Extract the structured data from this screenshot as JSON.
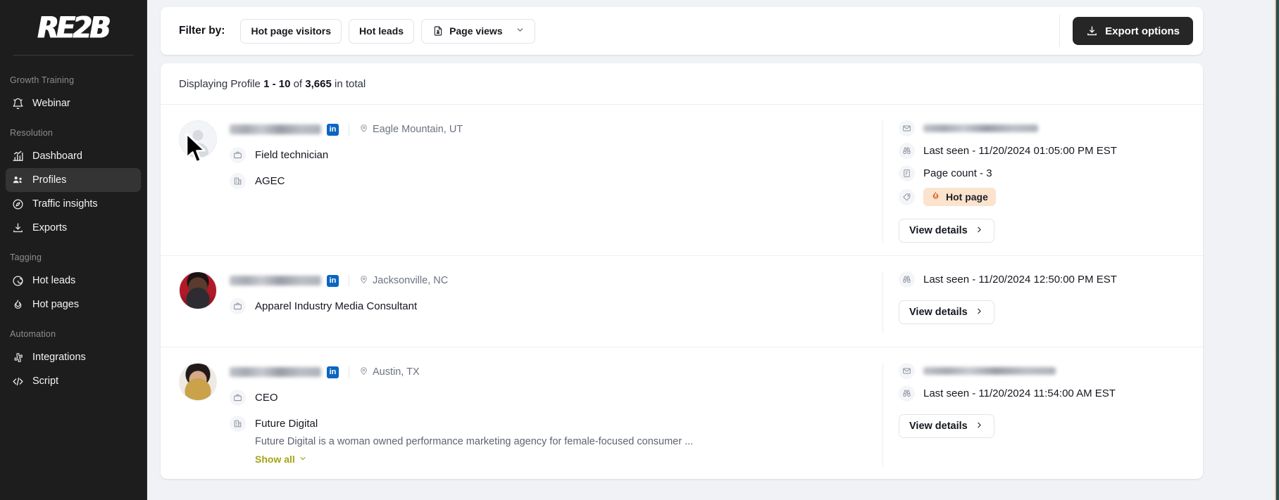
{
  "brand": {
    "logo_text": "RE2B"
  },
  "sidebar": {
    "sections": [
      {
        "title": "Growth Training",
        "items": [
          {
            "label": "Webinar",
            "icon": "bell-icon",
            "active": false
          }
        ]
      },
      {
        "title": "Resolution",
        "items": [
          {
            "label": "Dashboard",
            "icon": "chart-icon",
            "active": false
          },
          {
            "label": "Profiles",
            "icon": "people-icon",
            "active": true
          },
          {
            "label": "Traffic insights",
            "icon": "compass-icon",
            "active": false
          },
          {
            "label": "Exports",
            "icon": "download-icon",
            "active": false
          }
        ]
      },
      {
        "title": "Tagging",
        "items": [
          {
            "label": "Hot leads",
            "icon": "target-icon",
            "active": false
          },
          {
            "label": "Hot pages",
            "icon": "flame-icon",
            "active": false
          }
        ]
      },
      {
        "title": "Automation",
        "items": [
          {
            "label": "Integrations",
            "icon": "puzzle-icon",
            "active": false
          },
          {
            "label": "Script",
            "icon": "code-icon",
            "active": false
          }
        ]
      }
    ]
  },
  "filter_bar": {
    "label": "Filter by:",
    "chips": [
      {
        "label": "Hot page visitors",
        "icon": null,
        "has_chevron": false
      },
      {
        "label": "Hot leads",
        "icon": null,
        "has_chevron": false
      },
      {
        "label": "Page views",
        "icon": "page-icon",
        "has_chevron": true
      }
    ],
    "export_button": {
      "label": "Export options",
      "icon": "download-icon"
    }
  },
  "list": {
    "summary": {
      "prefix": "Displaying Profile",
      "range": "1 - 10",
      "of": "of",
      "total": "3,665",
      "suffix": "in total"
    },
    "profiles": [
      {
        "name_redacted": true,
        "linkedin_badge": "in",
        "location": "Eagle Mountain, UT",
        "avatar": "placeholder",
        "job_title": "Field technician",
        "company": "AGEC",
        "description": null,
        "show_all": null,
        "email_redacted": true,
        "last_seen": "Last seen - 11/20/2024 01:05:00 PM EST",
        "page_count": "Page count - 3",
        "tag": "Hot page",
        "view_details": "View details"
      },
      {
        "name_redacted": true,
        "linkedin_badge": "in",
        "location": "Jacksonville, NC",
        "avatar": "photo-red",
        "job_title": "Apparel Industry Media Consultant",
        "company": null,
        "description": null,
        "show_all": null,
        "email_redacted": false,
        "last_seen": "Last seen - 11/20/2024 12:50:00 PM EST",
        "page_count": null,
        "tag": null,
        "view_details": "View details"
      },
      {
        "name_redacted": true,
        "linkedin_badge": "in",
        "location": "Austin, TX",
        "avatar": "photo-light",
        "job_title": "CEO",
        "company": "Future Digital",
        "description": "Future Digital is a woman owned performance marketing agency for female-focused consumer ...",
        "show_all": "Show all",
        "email_redacted": true,
        "last_seen": "Last seen - 11/20/2024 11:54:00 AM EST",
        "page_count": null,
        "tag": null,
        "view_details": "View details"
      }
    ]
  },
  "colors": {
    "sidebar_bg": "#1d1d1d",
    "sidebar_active": "#343434",
    "page_bg": "#f1f2f6",
    "card_bg": "#ffffff",
    "accent_dark": "#262626",
    "linkedin": "#0a66c2",
    "hot_tag_bg": "#fbe3cd",
    "show_all": "#a6a416"
  }
}
